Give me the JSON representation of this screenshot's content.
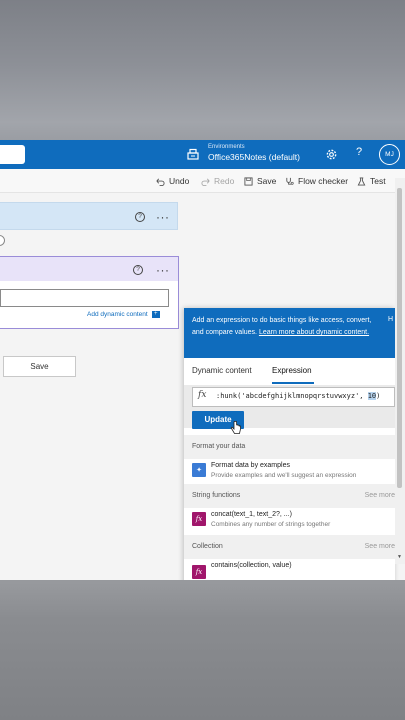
{
  "header": {
    "environments_label": "Environments",
    "environment_name": "Office365Notes (default)",
    "help_label": "?",
    "avatar_initials": "MJ"
  },
  "toolbar": {
    "undo": "Undo",
    "redo": "Redo",
    "save": "Save",
    "flow_checker": "Flow checker",
    "test": "Test"
  },
  "canvas": {
    "card1": {
      "help": "?",
      "menu": "···"
    },
    "card2": {
      "help": "?",
      "menu": "···",
      "add_dynamic_content": "Add dynamic content",
      "input_value": ""
    },
    "save_button": "Save"
  },
  "expression_panel": {
    "banner_text": "Add an expression to do basic things like access, convert, and compare values.",
    "banner_link": "Learn more about dynamic content.",
    "banner_close": "H",
    "tabs": [
      {
        "label": "Dynamic content",
        "selected": false
      },
      {
        "label": "Expression",
        "selected": true
      }
    ],
    "fx_symbol": "fx",
    "expression_text": ":hunk('abcdefghijklmnopqrstuvwxyz', ",
    "expression_selected": "10",
    "expression_end": ")",
    "update_button": "Update",
    "sections": [
      {
        "title": "Format your data",
        "see_more": "",
        "items": [
          {
            "title": "Format data by examples",
            "desc": "Provide examples and we'll suggest an expression",
            "icon": "wand-icon",
            "color": "#3a7bd5"
          }
        ]
      },
      {
        "title": "String functions",
        "see_more": "See more",
        "items": [
          {
            "title": "concat(text_1, text_2?, ...)",
            "desc": "Combines any number of strings together",
            "icon": "fx-icon",
            "color": "#a0166b"
          }
        ]
      },
      {
        "title": "Collection",
        "see_more": "See more",
        "items": [
          {
            "title": "contains(collection, value)",
            "desc": "",
            "icon": "fx-icon",
            "color": "#a0166b"
          }
        ]
      }
    ]
  },
  "colors": {
    "brand_blue": "#0f6cbd",
    "function_magenta": "#a0166b",
    "trigger_card": "#d4e6f6",
    "action_card_header": "#e8e3f9"
  }
}
